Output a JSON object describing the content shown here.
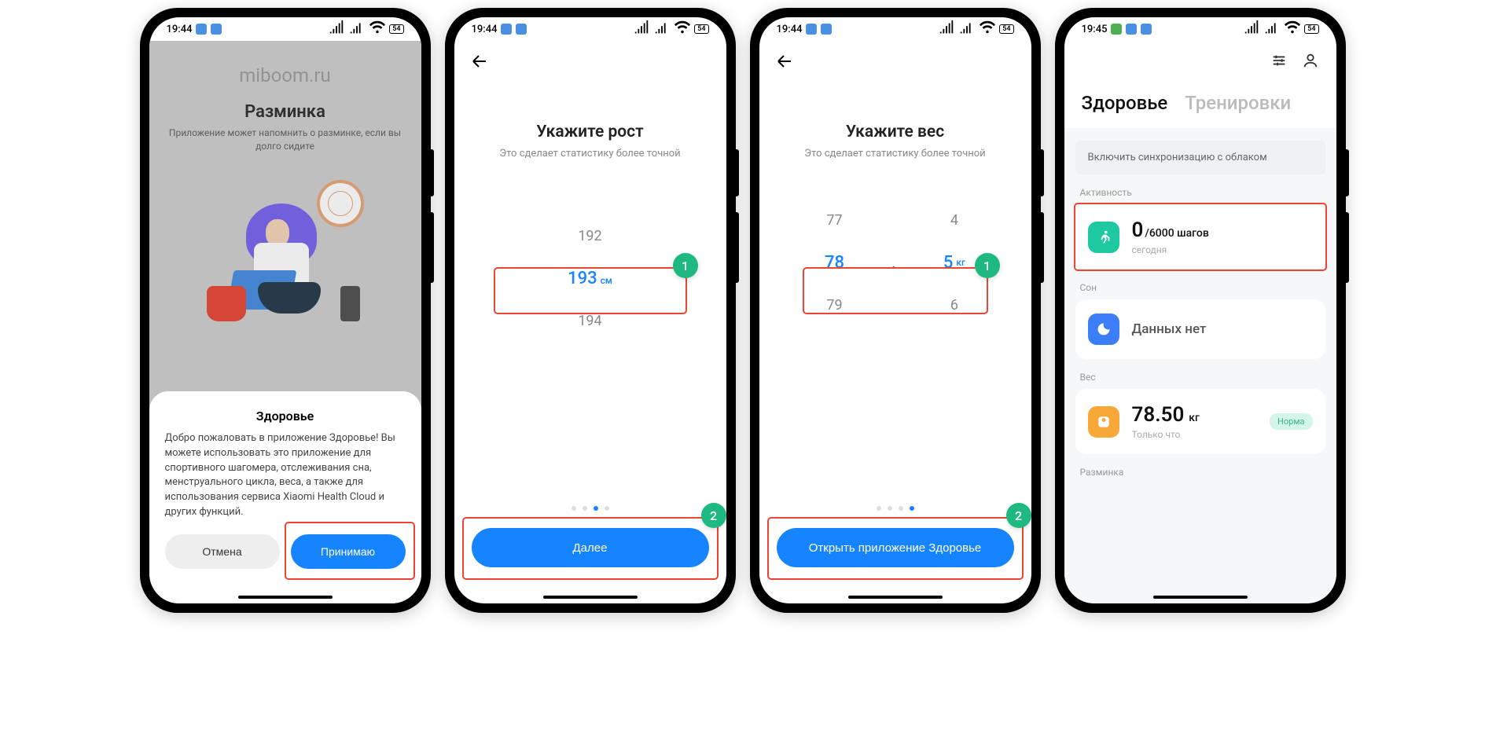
{
  "status": {
    "time1": "19:44",
    "time4": "19:45",
    "battery": "54"
  },
  "screen1": {
    "url": "miboom.ru",
    "title": "Разминка",
    "subtitle": "Приложение может напомнить о разминке, если вы долго сидите",
    "sheet_title": "Здоровье",
    "sheet_body": "Добро пожаловать в приложение Здоровье! Вы можете использовать это приложение для спортивного шагомера, отслеживания сна, менструального цикла, веса, а также для использования сервиса Xiaomi Health Cloud и других функций.",
    "cancel": "Отмена",
    "accept": "Принимаю"
  },
  "screen2": {
    "title": "Укажите рост",
    "subtitle": "Это сделает статистику более точной",
    "prev": "192",
    "current": "193",
    "unit": "см",
    "next": "194",
    "button": "Далее",
    "badge1": "1",
    "badge2": "2"
  },
  "screen3": {
    "title": "Укажите вес",
    "subtitle": "Это сделает статистику более точной",
    "int_prev": "77",
    "int_cur": "78",
    "int_next": "79",
    "dec_prev": "4",
    "dec_cur": "5",
    "dec_next": "6",
    "unit": "кг",
    "button": "Открыть приложение Здоровье",
    "badge1": "1",
    "badge2": "2"
  },
  "screen4": {
    "tab1": "Здоровье",
    "tab2": "Тренировки",
    "banner": "Включить синхронизацию с облаком",
    "activity_label": "Активность",
    "steps_value": "0",
    "steps_goal": "/6000 шагов",
    "steps_sub": "сегодня",
    "sleep_label": "Сон",
    "sleep_value": "Данных нет",
    "weight_label": "Вес",
    "weight_value": "78.50",
    "weight_unit": "кг",
    "weight_sub": "Только что",
    "weight_badge": "Норма",
    "warmup_label": "Разминка"
  }
}
